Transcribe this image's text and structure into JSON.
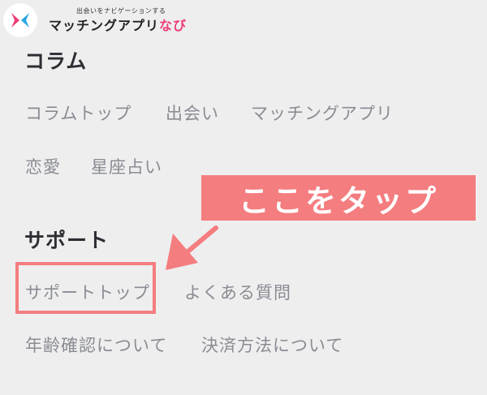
{
  "header": {
    "logo_tagline": "出会いをナビゲーションする",
    "logo_name_main": "マッチングアプリ",
    "logo_name_accent": "なび",
    "logo_icon": "chevrons-converge-icon"
  },
  "column_section": {
    "title": "コラム",
    "links": [
      "コラムトップ",
      "出会い",
      "マッチングアプリ",
      "恋愛",
      "星座占い"
    ]
  },
  "support_section": {
    "title": "サポート",
    "links": [
      "サポートトップ",
      "よくある質問",
      "年齢確認について",
      "決済方法について"
    ]
  },
  "annotation": {
    "callout_text": "ここをタップ",
    "arrow_icon": "arrow-down-left-icon"
  },
  "colors": {
    "accent_pink": "#ec3d76",
    "callout": "#f47d7f",
    "logo_blue": "#2aa6e0",
    "background": "#eeeeef"
  }
}
